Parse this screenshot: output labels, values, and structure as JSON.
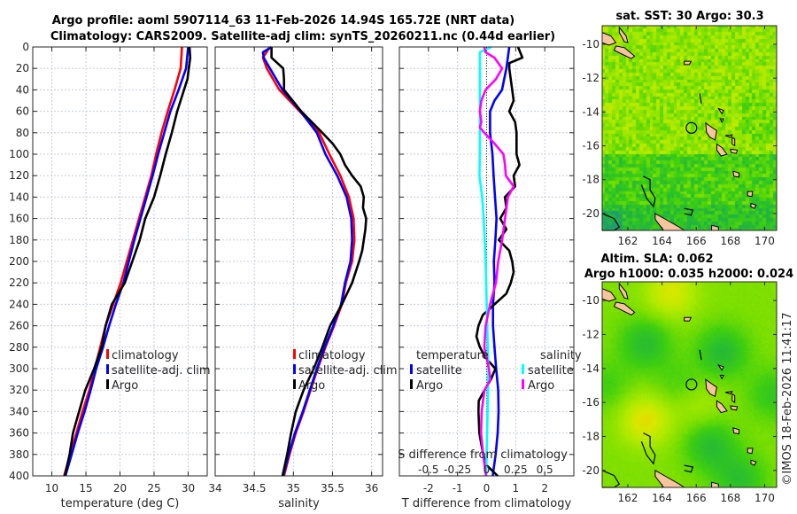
{
  "title": {
    "line1": "Argo profile: aoml 5907114_63 11-Feb-2026 14.94S 165.72E (NRT data)",
    "line2": "Climatology: CARS2009. Satellite-adj clim: synTS_20260211.nc (0.44d earlier)"
  },
  "watermark": "©IMOS 18-Feb-2026 11:41:17",
  "colors": {
    "climatology": "#ff0000",
    "satellite_T": "#0000ff",
    "argo_T": "#000000",
    "satellite_S": "#00ffff",
    "argo_S": "#ff00ff",
    "land": "#f7c4a0"
  },
  "chart_data": [
    {
      "type": "line",
      "xlabel": "temperature (deg C)",
      "xlim": [
        7.2,
        32.8
      ],
      "ylim": [
        400,
        0
      ],
      "xticks": [
        10,
        15,
        20,
        25,
        30
      ],
      "xtick_labels": [
        "10",
        "15",
        "20",
        "25",
        "30"
      ],
      "yticks": [
        0,
        20,
        40,
        60,
        80,
        100,
        120,
        140,
        160,
        180,
        200,
        220,
        240,
        260,
        280,
        300,
        320,
        340,
        360,
        380,
        400
      ],
      "ytick_labels": [
        "0",
        "20",
        "40",
        "60",
        "80",
        "100",
        "120",
        "140",
        "160",
        "180",
        "200",
        "220",
        "240",
        "260",
        "280",
        "300",
        "320",
        "340",
        "360",
        "380",
        "400"
      ],
      "grid": true,
      "legend": {
        "placement": "center-right",
        "entries": [
          "climatology",
          "satellite-adj. clim",
          "Argo"
        ]
      },
      "series": [
        {
          "name": "climatology",
          "color": "#ff0000",
          "depth": [
            0,
            20,
            40,
            60,
            80,
            100,
            120,
            140,
            160,
            180,
            200,
            220,
            240,
            260,
            280,
            300,
            320,
            340,
            360,
            380,
            400
          ],
          "values": [
            29.1,
            28.9,
            28.0,
            27.0,
            26.1,
            25.3,
            24.6,
            23.7,
            22.8,
            21.9,
            21.0,
            20.1,
            19.0,
            17.9,
            17.1,
            16.3,
            15.5,
            14.5,
            13.6,
            12.7,
            11.8
          ]
        },
        {
          "name": "satellite-adj. clim",
          "color": "#0000ff",
          "depth": [
            0,
            20,
            40,
            60,
            80,
            100,
            120,
            140,
            160,
            180,
            200,
            220,
            240,
            260,
            280,
            300,
            320,
            340,
            360,
            380,
            400
          ],
          "values": [
            30.0,
            29.7,
            28.6,
            27.4,
            26.5,
            25.6,
            24.8,
            23.9,
            23.0,
            22.1,
            21.3,
            20.5,
            19.4,
            18.4,
            17.5,
            16.5,
            15.7,
            14.8,
            13.8,
            12.9,
            12.0
          ]
        },
        {
          "name": "Argo",
          "color": "#000000",
          "depth": [
            0,
            10,
            20,
            30,
            40,
            60,
            80,
            100,
            120,
            140,
            160,
            180,
            200,
            220,
            240,
            260,
            280,
            300,
            320,
            340,
            360,
            380,
            400
          ],
          "values": [
            30.2,
            30.3,
            30.1,
            29.9,
            29.4,
            28.4,
            27.6,
            26.7,
            25.9,
            25.0,
            23.7,
            22.9,
            21.8,
            20.7,
            18.8,
            17.9,
            17.3,
            16.2,
            14.9,
            14.0,
            13.1,
            12.6,
            11.9
          ]
        }
      ]
    },
    {
      "type": "line",
      "xlabel": "salinity",
      "xlim": [
        34,
        36.14
      ],
      "ylim": [
        400,
        0
      ],
      "xticks": [
        34,
        34.5,
        35,
        35.5,
        36
      ],
      "xtick_labels": [
        "34",
        "34.5",
        "35",
        "35.5",
        "36"
      ],
      "yticks": [
        0,
        20,
        40,
        60,
        80,
        100,
        120,
        140,
        160,
        180,
        200,
        220,
        240,
        260,
        280,
        300,
        320,
        340,
        360,
        380,
        400
      ],
      "grid": true,
      "legend": {
        "placement": "center-right",
        "entries": [
          "climatology",
          "satellite-adj. clim",
          "Argo"
        ]
      },
      "series": [
        {
          "name": "climatology",
          "color": "#ff0000",
          "depth": [
            0,
            10,
            20,
            40,
            60,
            80,
            100,
            120,
            140,
            160,
            180,
            200,
            220,
            240,
            260,
            280,
            300,
            320,
            340,
            360,
            380,
            400
          ],
          "values": [
            34.7,
            34.61,
            34.66,
            34.82,
            35.08,
            35.33,
            35.46,
            35.6,
            35.71,
            35.77,
            35.78,
            35.75,
            35.67,
            35.62,
            35.52,
            35.41,
            35.31,
            35.22,
            35.13,
            35.03,
            34.95,
            34.88
          ]
        },
        {
          "name": "satellite-adj. clim",
          "color": "#0000ff",
          "depth": [
            0,
            5,
            10,
            20,
            40,
            60,
            80,
            100,
            120,
            140,
            160,
            180,
            200,
            220,
            240,
            260,
            280,
            300,
            320,
            340,
            360,
            380,
            400
          ],
          "values": [
            34.72,
            34.61,
            34.62,
            34.7,
            34.86,
            35.09,
            35.3,
            35.41,
            35.56,
            35.68,
            35.74,
            35.75,
            35.73,
            35.66,
            35.61,
            35.51,
            35.4,
            35.3,
            35.21,
            35.12,
            35.02,
            34.94,
            34.87
          ]
        },
        {
          "name": "Argo",
          "color": "#000000",
          "depth": [
            0,
            10,
            20,
            30,
            40,
            60,
            80,
            90,
            100,
            110,
            120,
            130,
            140,
            150,
            160,
            170,
            180,
            190,
            200,
            220,
            240,
            260,
            280,
            300,
            320,
            340,
            360,
            380,
            400
          ],
          "values": [
            34.72,
            34.72,
            34.87,
            34.88,
            34.88,
            35.1,
            35.37,
            35.5,
            35.6,
            35.66,
            35.75,
            35.86,
            35.9,
            35.89,
            35.93,
            35.92,
            35.9,
            35.88,
            35.84,
            35.75,
            35.62,
            35.47,
            35.37,
            35.26,
            35.13,
            35.03,
            34.97,
            34.92,
            34.86
          ]
        }
      ]
    },
    {
      "type": "line",
      "xlabel": "T difference from climatology",
      "xlim": [
        -3,
        3
      ],
      "ylim": [
        400,
        0
      ],
      "xticks": [
        -2,
        -1,
        0,
        1,
        2
      ],
      "xtick_labels": [
        "-2",
        "-1",
        "0",
        "1",
        "2"
      ],
      "secondary_xlabel": "S difference from climatology",
      "secondary_xlim": [
        -0.75,
        0.75
      ],
      "secondary_xticks": [
        -0.5,
        -0.25,
        0,
        0.25,
        0.5
      ],
      "secondary_xtick_labels": [
        "-0.5",
        "-0.25",
        "0",
        "0.25",
        "0.5"
      ],
      "yticks": [
        0,
        20,
        40,
        60,
        80,
        100,
        120,
        140,
        160,
        180,
        200,
        220,
        240,
        260,
        280,
        300,
        320,
        340,
        360,
        380,
        400
      ],
      "grid": true,
      "legend": {
        "placement": "bottom",
        "temperature": {
          "heading": "temperature",
          "entries": [
            "satellite",
            "Argo"
          ]
        },
        "salinity": {
          "heading": "salinity",
          "entries": [
            "satellite",
            "Argo"
          ]
        }
      },
      "series": [
        {
          "name": "satellite",
          "variable": "temperature",
          "color": "#0000ff",
          "depth": [
            0,
            20,
            40,
            50,
            60,
            80,
            100,
            120,
            140,
            160,
            180,
            200,
            220,
            240,
            260,
            280,
            300,
            320,
            340,
            360,
            380,
            400
          ],
          "values": [
            0.78,
            0.68,
            0.53,
            0.27,
            0.12,
            0.12,
            0.2,
            0.24,
            0.29,
            0.34,
            0.3,
            0.25,
            0.27,
            0.22,
            0.22,
            0.27,
            0.33,
            0.4,
            0.41,
            0.38,
            0.31,
            0.21
          ]
        },
        {
          "name": "Argo",
          "variable": "temperature",
          "color": "#000000",
          "depth": [
            0,
            10,
            15,
            20,
            40,
            50,
            60,
            70,
            80,
            100,
            110,
            120,
            130,
            140,
            150,
            160,
            170,
            180,
            190,
            200,
            210,
            220,
            230,
            240,
            250,
            260,
            270,
            280,
            290,
            300,
            310,
            320,
            330,
            340,
            360,
            380,
            390,
            400
          ],
          "values": [
            1.08,
            1.23,
            0.78,
            0.78,
            0.88,
            0.93,
            0.78,
            0.98,
            1.03,
            1.03,
            1.13,
            0.93,
            0.98,
            0.63,
            0.68,
            0.47,
            0.68,
            0.42,
            0.78,
            0.88,
            0.93,
            0.83,
            0.68,
            0.27,
            -0.13,
            -0.28,
            -0.35,
            -0.23,
            -0.03,
            0.3,
            0.15,
            -0.07,
            -0.27,
            -0.28,
            -0.25,
            -0.12,
            0.0,
            0.38
          ]
        },
        {
          "name": "satellite",
          "variable": "salinity",
          "color": "#00ffff",
          "depth": [
            0,
            5,
            20,
            60,
            100,
            120,
            140,
            160,
            200,
            260,
            300,
            340,
            380,
            400
          ],
          "values": [
            0.042,
            -0.058,
            -0.058,
            -0.058,
            -0.058,
            -0.062,
            -0.038,
            -0.025,
            -0.008,
            0.005,
            0.015,
            0.008,
            0,
            -0.002
          ]
        },
        {
          "name": "Argo",
          "variable": "salinity",
          "color": "#ff00ff",
          "depth": [
            0,
            5,
            10,
            20,
            30,
            40,
            50,
            60,
            70,
            75,
            80,
            90,
            100,
            110,
            120,
            130,
            140,
            160,
            180,
            200,
            220,
            240,
            260,
            280,
            300,
            310,
            320,
            340,
            360,
            380,
            400
          ],
          "values": [
            -0.02,
            -0.008,
            0.068,
            0.133,
            0.08,
            -0.008,
            -0.045,
            -0.058,
            -0.045,
            -0.058,
            -0.02,
            0.068,
            0.145,
            0.158,
            0.165,
            0.233,
            0.183,
            0.158,
            0.133,
            0.1,
            0.08,
            0.03,
            -0.008,
            -0.02,
            0.02,
            0.033,
            -0.018,
            -0.043,
            -0.048,
            -0.03,
            -0.005
          ]
        }
      ]
    },
    {
      "type": "heatmap",
      "title": "sat. SST: 30 Argo: 30.3",
      "xlim": [
        160.5,
        170.7
      ],
      "ylim": [
        -21,
        -8.9
      ],
      "xticks": [
        162,
        164,
        166,
        168,
        170
      ],
      "xtick_labels": [
        "162",
        "164",
        "166",
        "168",
        "170"
      ],
      "yticks": [
        -10,
        -12,
        -14,
        -16,
        -18,
        -20
      ],
      "ytick_labels": [
        "-10",
        "-12",
        "-14",
        "-16",
        "-18",
        "-20"
      ],
      "profile_location": {
        "lon": 165.72,
        "lat": -14.94
      }
    },
    {
      "type": "heatmap",
      "title": "Altim. SLA: 0.062",
      "subtitle": "Argo h1000: 0.035 h2000: 0.024",
      "xlim": [
        160.5,
        170.7
      ],
      "ylim": [
        -21,
        -8.9
      ],
      "xticks": [
        162,
        164,
        166,
        168,
        170
      ],
      "xtick_labels": [
        "162",
        "164",
        "166",
        "168",
        "170"
      ],
      "yticks": [
        -10,
        -12,
        -14,
        -16,
        -18,
        -20
      ],
      "ytick_labels": [
        "-10",
        "-12",
        "-14",
        "-16",
        "-18",
        "-20"
      ],
      "profile_location": {
        "lon": 165.72,
        "lat": -14.94
      }
    }
  ]
}
